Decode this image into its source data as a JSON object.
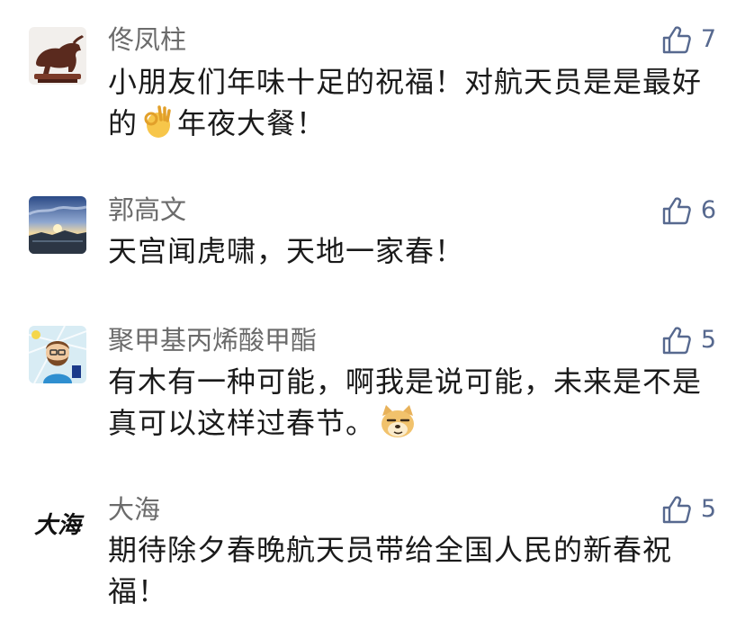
{
  "comments": [
    {
      "name": "佟凤柱",
      "likes": "7",
      "line1": "小朋友们年味十足的祝福！对航天员是是最好",
      "line2_pre": "的",
      "line2_post": "年夜大餐！",
      "emoji": "ok-hand-emoji"
    },
    {
      "name": "郭高文",
      "likes": "6",
      "line1": "天宫闻虎啸，天地一家春！"
    },
    {
      "name": "聚甲基丙烯酸甲酯",
      "likes": "5",
      "line1": "有木有一种可能，啊我是说可能，未来是不是",
      "line2_pre": "真可以这样过春节。",
      "emoji": "doge-emoji"
    },
    {
      "name": "大海",
      "likes": "5",
      "avatar_text": "大海",
      "line1": "期待除夕春晚航天员带给全国人民的新春祝",
      "line2_pre": "福！"
    }
  ],
  "colors": {
    "name": "#6b6b6b",
    "text": "#1a1a1a",
    "like": "#57698f"
  }
}
